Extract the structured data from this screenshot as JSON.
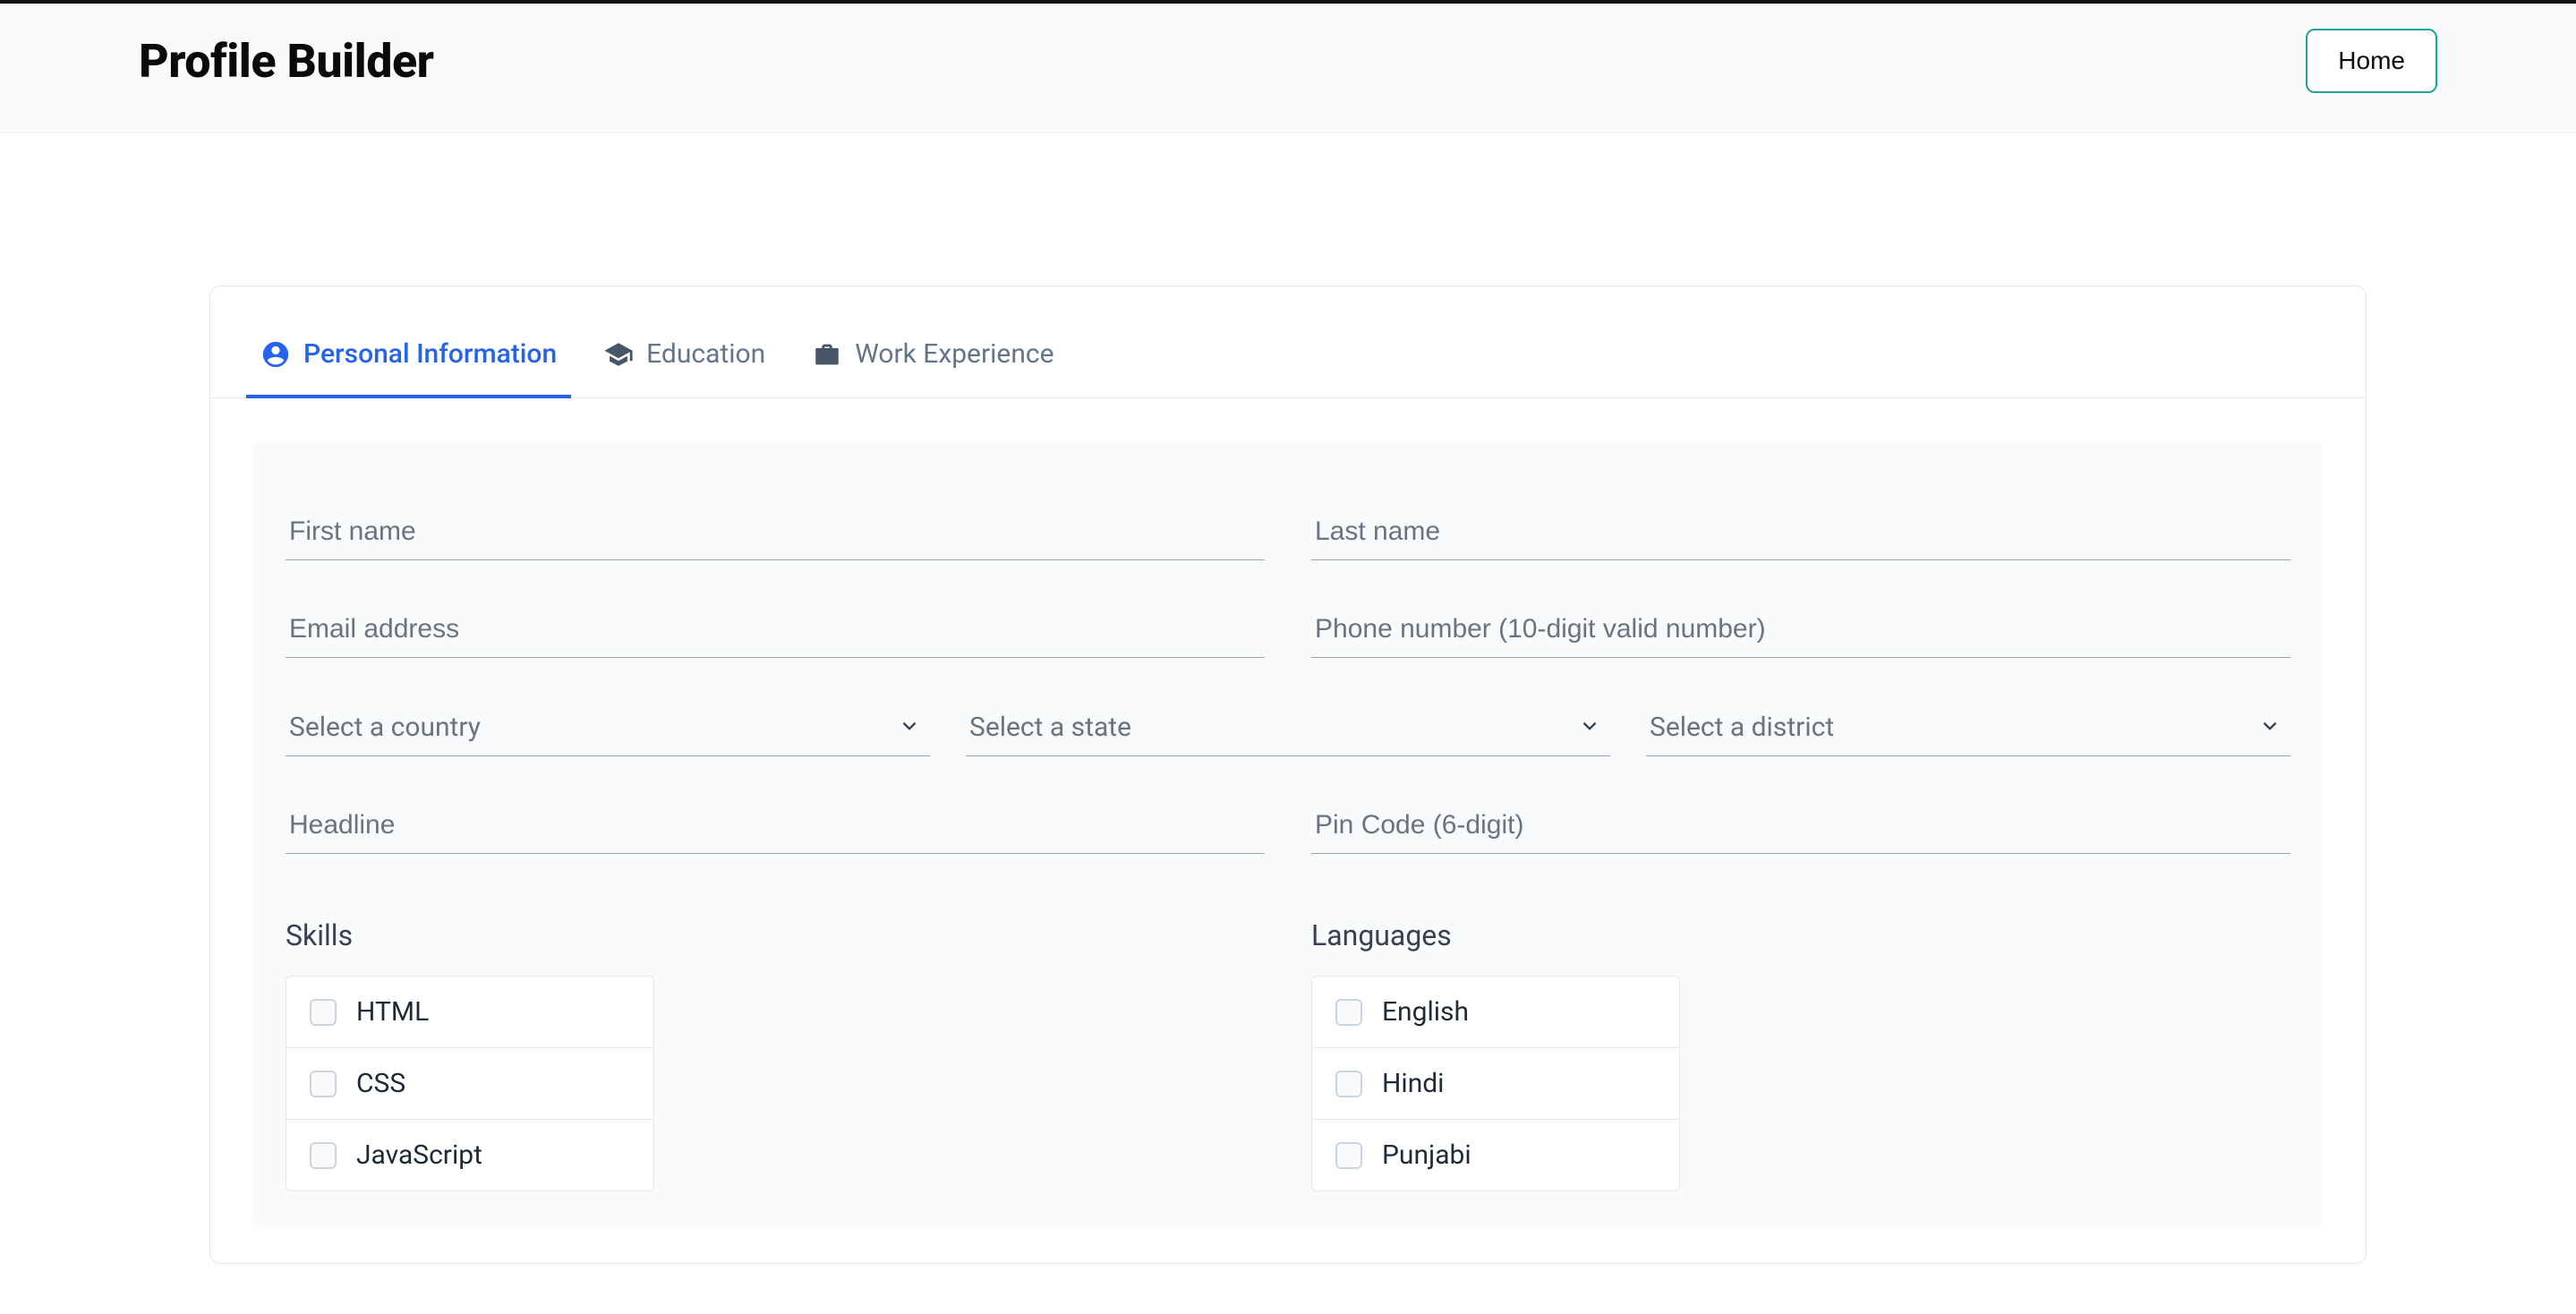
{
  "header": {
    "title": "Profile Builder",
    "home_label": "Home"
  },
  "tabs": {
    "personal": "Personal Information",
    "education": "Education",
    "work": "Work Experience"
  },
  "form": {
    "first_name_placeholder": "First name",
    "last_name_placeholder": "Last name",
    "email_placeholder": "Email address",
    "phone_placeholder": "Phone number (10-digit valid number)",
    "country_placeholder": "Select a country",
    "state_placeholder": "Select a state",
    "district_placeholder": "Select a district",
    "headline_placeholder": "Headline",
    "pincode_placeholder": "Pin Code (6-digit)"
  },
  "skills": {
    "title": "Skills",
    "items": [
      "HTML",
      "CSS",
      "JavaScript"
    ]
  },
  "languages": {
    "title": "Languages",
    "items": [
      "English",
      "Hindi",
      "Punjabi"
    ]
  }
}
